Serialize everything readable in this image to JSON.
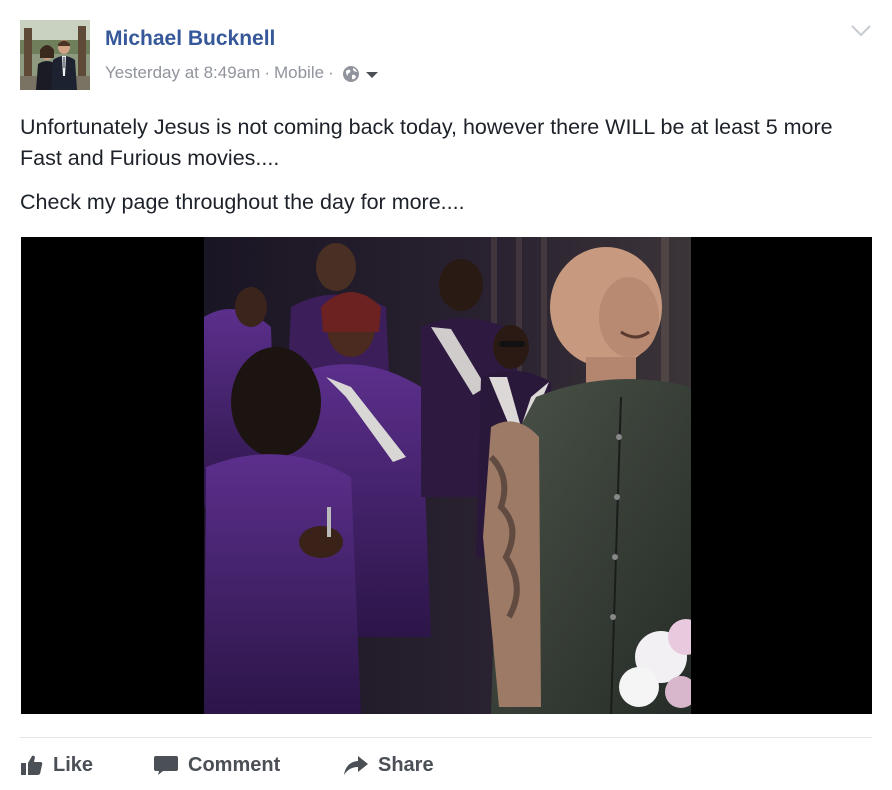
{
  "post": {
    "author": "Michael Bucknell",
    "timestamp": "Yesterday at 8:49am",
    "source": "Mobile",
    "separator": "·",
    "privacy_icon": "globe-icon",
    "paragraphs": [
      "Unfortunately Jesus is not coming back today, however there WILL be at least 5 more Fast and Furious movies....",
      "Check my page throughout the day for more...."
    ]
  },
  "actions": {
    "like": "Like",
    "comment": "Comment",
    "share": "Share"
  },
  "colors": {
    "link_blue": "#365899",
    "meta_gray": "#90949c",
    "action_gray": "#4b4f56"
  }
}
